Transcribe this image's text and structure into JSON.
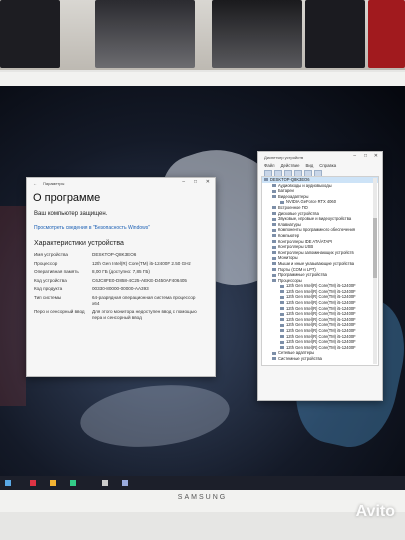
{
  "about": {
    "window_title": "Параметры",
    "heading": "О программе",
    "protected": "Ваш компьютер защищен.",
    "link": "Просмотреть сведения в \"Безопасность Windows\"",
    "section_title": "Характеристики устройства",
    "specs": [
      {
        "k": "Имя устройства",
        "v": "DESKTOP-Q8K3EO6"
      },
      {
        "k": "Процессор",
        "v": "12th Gen Intel(R) Core(TM) i5-12400F 2.50 GHz"
      },
      {
        "k": "Оперативная память",
        "v": "8,00 ГБ (доступно: 7,85 ГБ)"
      },
      {
        "k": "Код устройства",
        "v": "C6JC8FE0-D858-4C25-AEKE-D450AF406405"
      },
      {
        "k": "Код продукта",
        "v": "00330-80000-00000-AA393"
      },
      {
        "k": "Тип системы",
        "v": "64-разрядная операционная система процессор x64"
      },
      {
        "k": "Перо и сенсорный ввод",
        "v": "Для этого монитора недоступен ввод с помощью пера и сенсорный ввод"
      }
    ]
  },
  "devmgr": {
    "window_title": "Диспетчер устройств",
    "menu": [
      "Файл",
      "Действие",
      "Вид",
      "Справка"
    ],
    "tree": [
      {
        "t": "DESKTOP-Q8K3EO6",
        "lvl": 0
      },
      {
        "t": "Аудиовходы и аудиовыходы",
        "lvl": 1
      },
      {
        "t": "Батареи",
        "lvl": 1
      },
      {
        "t": "Видеоадаптеры",
        "lvl": 1
      },
      {
        "t": "NVIDIA GeForce RTX 4060",
        "lvl": 2
      },
      {
        "t": "Встроенное ПО",
        "lvl": 1
      },
      {
        "t": "Дисковые устройства",
        "lvl": 1
      },
      {
        "t": "Звуковые, игровые и видеоустройства",
        "lvl": 1
      },
      {
        "t": "Клавиатуры",
        "lvl": 1
      },
      {
        "t": "Компоненты программного обеспечения",
        "lvl": 1
      },
      {
        "t": "Компьютер",
        "lvl": 1
      },
      {
        "t": "Контроллеры IDE ATA/ATAPI",
        "lvl": 1
      },
      {
        "t": "Контроллеры USB",
        "lvl": 1
      },
      {
        "t": "Контроллеры запоминающих устройств",
        "lvl": 1
      },
      {
        "t": "Мониторы",
        "lvl": 1
      },
      {
        "t": "Мыши и иные указывающие устройства",
        "lvl": 1
      },
      {
        "t": "Порты (COM и LPT)",
        "lvl": 1
      },
      {
        "t": "Программные устройства",
        "lvl": 1
      },
      {
        "t": "Процессоры",
        "lvl": 1
      },
      {
        "t": "12th Gen Intel(R) Core(TM) i5-12400F",
        "lvl": 2
      },
      {
        "t": "12th Gen Intel(R) Core(TM) i5-12400F",
        "lvl": 2
      },
      {
        "t": "12th Gen Intel(R) Core(TM) i5-12400F",
        "lvl": 2
      },
      {
        "t": "12th Gen Intel(R) Core(TM) i5-12400F",
        "lvl": 2
      },
      {
        "t": "12th Gen Intel(R) Core(TM) i5-12400F",
        "lvl": 2
      },
      {
        "t": "12th Gen Intel(R) Core(TM) i5-12400F",
        "lvl": 2
      },
      {
        "t": "12th Gen Intel(R) Core(TM) i5-12400F",
        "lvl": 2
      },
      {
        "t": "12th Gen Intel(R) Core(TM) i5-12400F",
        "lvl": 2
      },
      {
        "t": "12th Gen Intel(R) Core(TM) i5-12400F",
        "lvl": 2
      },
      {
        "t": "12th Gen Intel(R) Core(TM) i5-12400F",
        "lvl": 2
      },
      {
        "t": "12th Gen Intel(R) Core(TM) i5-12400F",
        "lvl": 2
      },
      {
        "t": "12th Gen Intel(R) Core(TM) i5-12400F",
        "lvl": 2
      },
      {
        "t": "Сетевые адаптеры",
        "lvl": 1
      },
      {
        "t": "Системные устройства",
        "lvl": 1
      }
    ]
  },
  "monitor": {
    "brand": "SAMSUNG"
  },
  "watermark": "Avito"
}
